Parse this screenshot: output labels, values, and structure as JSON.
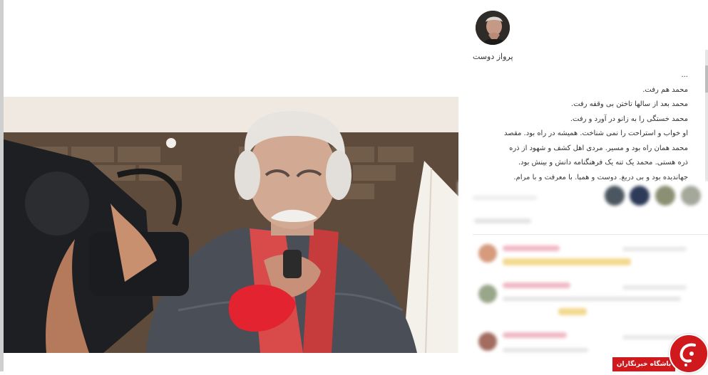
{
  "post": {
    "username": "پرواز دوست",
    "caption_lines": [
      "...",
      "محمد هم رفت.",
      "محمد بعد از سالها تاختن بی وقفه رفت.",
      "محمد خستگی را به زانو در آورد و رفت.",
      "او خواب و استراحت را نمی شناخت. همیشه در راه بود. مقصد",
      "محمد همان راه بود و مسیر. مردی اهل کشف و شهود از ذره",
      "ذره هستی. محمد یک تنه یک فرهنگنامه دانش و بینش بود.",
      "جهاندیده بود و بی دریغ. دوست و همپا. با معرفت و با مرام."
    ]
  },
  "watermark": {
    "label": "باشگاه خبرنگاران"
  },
  "colors": {
    "watermark_red": "#d0191c",
    "text": "#333333"
  }
}
